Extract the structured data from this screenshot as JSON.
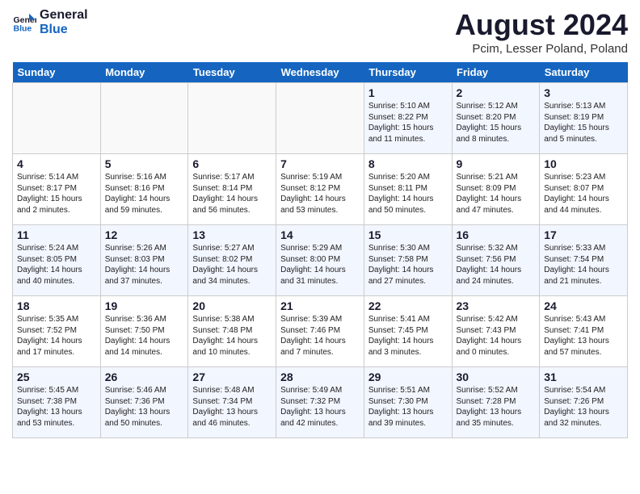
{
  "logo": {
    "line1": "General",
    "line2": "Blue"
  },
  "title": "August 2024",
  "location": "Pcim, Lesser Poland, Poland",
  "days_of_week": [
    "Sunday",
    "Monday",
    "Tuesday",
    "Wednesday",
    "Thursday",
    "Friday",
    "Saturday"
  ],
  "weeks": [
    [
      {
        "day": "",
        "info": ""
      },
      {
        "day": "",
        "info": ""
      },
      {
        "day": "",
        "info": ""
      },
      {
        "day": "",
        "info": ""
      },
      {
        "day": "1",
        "info": "Sunrise: 5:10 AM\nSunset: 8:22 PM\nDaylight: 15 hours\nand 11 minutes."
      },
      {
        "day": "2",
        "info": "Sunrise: 5:12 AM\nSunset: 8:20 PM\nDaylight: 15 hours\nand 8 minutes."
      },
      {
        "day": "3",
        "info": "Sunrise: 5:13 AM\nSunset: 8:19 PM\nDaylight: 15 hours\nand 5 minutes."
      }
    ],
    [
      {
        "day": "4",
        "info": "Sunrise: 5:14 AM\nSunset: 8:17 PM\nDaylight: 15 hours\nand 2 minutes."
      },
      {
        "day": "5",
        "info": "Sunrise: 5:16 AM\nSunset: 8:16 PM\nDaylight: 14 hours\nand 59 minutes."
      },
      {
        "day": "6",
        "info": "Sunrise: 5:17 AM\nSunset: 8:14 PM\nDaylight: 14 hours\nand 56 minutes."
      },
      {
        "day": "7",
        "info": "Sunrise: 5:19 AM\nSunset: 8:12 PM\nDaylight: 14 hours\nand 53 minutes."
      },
      {
        "day": "8",
        "info": "Sunrise: 5:20 AM\nSunset: 8:11 PM\nDaylight: 14 hours\nand 50 minutes."
      },
      {
        "day": "9",
        "info": "Sunrise: 5:21 AM\nSunset: 8:09 PM\nDaylight: 14 hours\nand 47 minutes."
      },
      {
        "day": "10",
        "info": "Sunrise: 5:23 AM\nSunset: 8:07 PM\nDaylight: 14 hours\nand 44 minutes."
      }
    ],
    [
      {
        "day": "11",
        "info": "Sunrise: 5:24 AM\nSunset: 8:05 PM\nDaylight: 14 hours\nand 40 minutes."
      },
      {
        "day": "12",
        "info": "Sunrise: 5:26 AM\nSunset: 8:03 PM\nDaylight: 14 hours\nand 37 minutes."
      },
      {
        "day": "13",
        "info": "Sunrise: 5:27 AM\nSunset: 8:02 PM\nDaylight: 14 hours\nand 34 minutes."
      },
      {
        "day": "14",
        "info": "Sunrise: 5:29 AM\nSunset: 8:00 PM\nDaylight: 14 hours\nand 31 minutes."
      },
      {
        "day": "15",
        "info": "Sunrise: 5:30 AM\nSunset: 7:58 PM\nDaylight: 14 hours\nand 27 minutes."
      },
      {
        "day": "16",
        "info": "Sunrise: 5:32 AM\nSunset: 7:56 PM\nDaylight: 14 hours\nand 24 minutes."
      },
      {
        "day": "17",
        "info": "Sunrise: 5:33 AM\nSunset: 7:54 PM\nDaylight: 14 hours\nand 21 minutes."
      }
    ],
    [
      {
        "day": "18",
        "info": "Sunrise: 5:35 AM\nSunset: 7:52 PM\nDaylight: 14 hours\nand 17 minutes."
      },
      {
        "day": "19",
        "info": "Sunrise: 5:36 AM\nSunset: 7:50 PM\nDaylight: 14 hours\nand 14 minutes."
      },
      {
        "day": "20",
        "info": "Sunrise: 5:38 AM\nSunset: 7:48 PM\nDaylight: 14 hours\nand 10 minutes."
      },
      {
        "day": "21",
        "info": "Sunrise: 5:39 AM\nSunset: 7:46 PM\nDaylight: 14 hours\nand 7 minutes."
      },
      {
        "day": "22",
        "info": "Sunrise: 5:41 AM\nSunset: 7:45 PM\nDaylight: 14 hours\nand 3 minutes."
      },
      {
        "day": "23",
        "info": "Sunrise: 5:42 AM\nSunset: 7:43 PM\nDaylight: 14 hours\nand 0 minutes."
      },
      {
        "day": "24",
        "info": "Sunrise: 5:43 AM\nSunset: 7:41 PM\nDaylight: 13 hours\nand 57 minutes."
      }
    ],
    [
      {
        "day": "25",
        "info": "Sunrise: 5:45 AM\nSunset: 7:38 PM\nDaylight: 13 hours\nand 53 minutes."
      },
      {
        "day": "26",
        "info": "Sunrise: 5:46 AM\nSunset: 7:36 PM\nDaylight: 13 hours\nand 50 minutes."
      },
      {
        "day": "27",
        "info": "Sunrise: 5:48 AM\nSunset: 7:34 PM\nDaylight: 13 hours\nand 46 minutes."
      },
      {
        "day": "28",
        "info": "Sunrise: 5:49 AM\nSunset: 7:32 PM\nDaylight: 13 hours\nand 42 minutes."
      },
      {
        "day": "29",
        "info": "Sunrise: 5:51 AM\nSunset: 7:30 PM\nDaylight: 13 hours\nand 39 minutes."
      },
      {
        "day": "30",
        "info": "Sunrise: 5:52 AM\nSunset: 7:28 PM\nDaylight: 13 hours\nand 35 minutes."
      },
      {
        "day": "31",
        "info": "Sunrise: 5:54 AM\nSunset: 7:26 PM\nDaylight: 13 hours\nand 32 minutes."
      }
    ]
  ]
}
